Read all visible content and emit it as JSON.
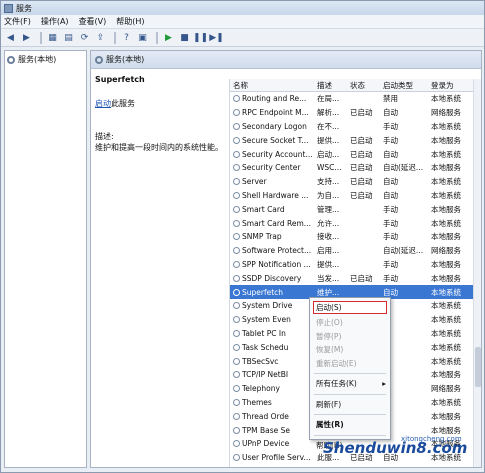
{
  "window": {
    "title": "服务"
  },
  "menu": [
    "文件(F)",
    "操作(A)",
    "查看(V)",
    "帮助(H)"
  ],
  "toolbar": [
    "back-icon",
    "forward-icon",
    "view-icon",
    "console-icon",
    "refresh-icon",
    "export-icon",
    "help-icon",
    "properties-icon",
    "play-icon",
    "stop-icon",
    "pause-icon",
    "restart-icon"
  ],
  "left": {
    "tree_label": "服务(本地)"
  },
  "right": {
    "header": "服务(本地)",
    "service_name": "Superfetch",
    "start_link": "启动",
    "start_suffix": "此服务",
    "desc_label": "描述:",
    "desc_text": "维护和提高一段时间内的系统性能。"
  },
  "columns": [
    "名称",
    "描述",
    "状态",
    "启动类型",
    "登录为"
  ],
  "rows": [
    [
      "Routing and Re...",
      "在局...",
      "",
      "禁用",
      "本地系统"
    ],
    [
      "RPC Endpoint M...",
      "解析...",
      "已启动",
      "自动",
      "网络服务"
    ],
    [
      "Secondary Logon",
      "在不...",
      "",
      "手动",
      "本地系统"
    ],
    [
      "Secure Socket T...",
      "提供...",
      "已启动",
      "手动",
      "本地服务"
    ],
    [
      "Security Account...",
      "启动...",
      "已启动",
      "自动",
      "本地系统"
    ],
    [
      "Security Center",
      "WSC...",
      "已启动",
      "自动(延迟...",
      "本地服务"
    ],
    [
      "Server",
      "支持...",
      "已启动",
      "自动",
      "本地系统"
    ],
    [
      "Shell Hardware ...",
      "为自...",
      "已启动",
      "自动",
      "本地系统"
    ],
    [
      "Smart Card",
      "管理...",
      "",
      "手动",
      "本地服务"
    ],
    [
      "Smart Card Rem...",
      "允许...",
      "",
      "手动",
      "本地系统"
    ],
    [
      "SNMP Trap",
      "接收...",
      "",
      "手动",
      "本地服务"
    ],
    [
      "Software Protect...",
      "启用...",
      "",
      "自动(延迟...",
      "网络服务"
    ],
    [
      "SPP Notification ...",
      "提供...",
      "",
      "手动",
      "本地服务"
    ],
    [
      "SSDP Discovery",
      "当发...",
      "已启动",
      "手动",
      "本地服务"
    ],
    [
      "Superfetch",
      "维护...",
      "",
      "自动",
      "本地系统"
    ],
    [
      "System Drive",
      "",
      "",
      "",
      "本地系统"
    ],
    [
      "System Even",
      "",
      "",
      "",
      "本地系统"
    ],
    [
      "Tablet PC In",
      "",
      "",
      "",
      "本地系统"
    ],
    [
      "Task Schedu",
      "",
      "",
      "",
      "本地系统"
    ],
    [
      "TBSecSvc",
      "",
      "",
      "",
      "本地系统"
    ],
    [
      "TCP/IP NetBI",
      "",
      "",
      "",
      "本地服务"
    ],
    [
      "Telephony",
      "",
      "",
      "",
      "网络服务"
    ],
    [
      "Themes",
      "",
      "",
      "",
      "本地系统"
    ],
    [
      "Thread Orde",
      "",
      "",
      "",
      "本地服务"
    ],
    [
      "TPM Base Se",
      "",
      "",
      "",
      "本地服务"
    ],
    [
      "UPnP Device",
      "",
      "",
      "",
      "本地服务"
    ],
    [
      "User Profile Serv...",
      "此服...",
      "已启动",
      "自动",
      "本地系统"
    ]
  ],
  "context_menu": {
    "start": "启动(S)",
    "stop": "停止(O)",
    "pause": "暂停(P)",
    "resume": "恢复(M)",
    "restart": "重新启动(E)",
    "all_tasks": "所有任务(K)",
    "refresh": "刷新(F)",
    "properties": "属性(R)",
    "help": "帮助(H)"
  },
  "watermark": {
    "brand": "Shenduwin8.com",
    "small": "xitongcheng.com"
  }
}
